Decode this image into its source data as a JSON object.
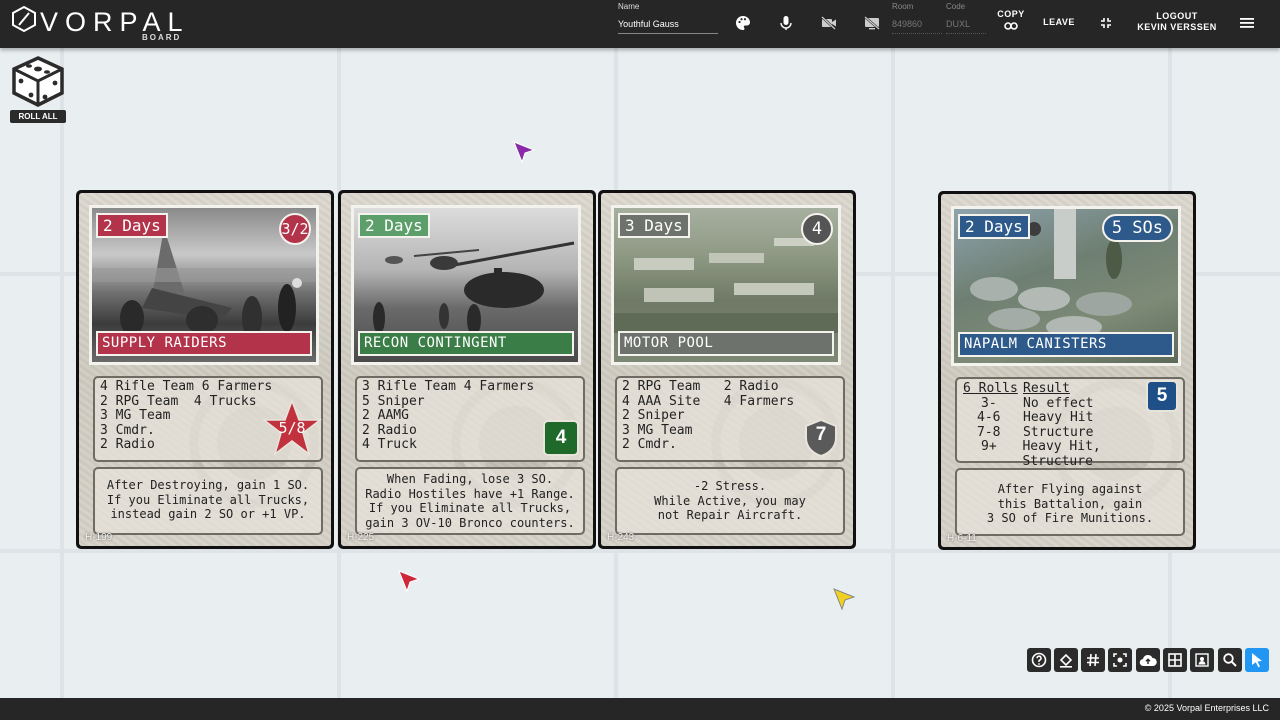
{
  "app": {
    "logo_text": "VORPAL",
    "logo_sub": "BOARD"
  },
  "header": {
    "name_label": "Name",
    "name_value": "Youthful Gauss",
    "room_label": "Room",
    "room_value": "849860",
    "code_label": "Code",
    "code_value": "DUXL",
    "copy_label": "COPY",
    "leave_label": "LEAVE",
    "logout_label": "LOGOUT",
    "user_name": "KEVIN VERSSEN"
  },
  "dice": {
    "label": "ROLL ALL"
  },
  "cards": [
    {
      "days": "2 Days",
      "title": "SUPPLY RAIDERS",
      "badge": "3/2",
      "units": "4 Rifle Team 6 Farmers\n2 RPG Team  4 Trucks\n3 MG Team\n3 Cmdr.\n2 Radio",
      "star_value": "5/8",
      "text": "After Destroying, gain 1 SO.\nIf you Eliminate all Trucks,\ninstead gain 2 SO or +1 VP.",
      "id": "H-199",
      "accent": "#b3344a"
    },
    {
      "days": "2 Days",
      "title": "RECON CONTINGENT",
      "badge": "",
      "units": "3 Rifle Team 4 Farmers\n5 Sniper\n2 AAMG\n2 Radio\n4 Truck",
      "square_value": "4",
      "text": "When Fading, lose 3 SO.\nRadio Hostiles have +1 Range.\nIf you Eliminate all Trucks,\ngain 3 OV-10 Bronco counters.",
      "id": "H-225",
      "accent": "#3a7d46"
    },
    {
      "days": "3 Days",
      "title": "MOTOR POOL",
      "badge": "4",
      "units": "2 RPG Team   2 Radio\n4 AAA Site   4 Farmers\n2 Sniper\n3 MG Team\n2 Cmdr.",
      "shield_value": "7",
      "text": "-2 Stress.\nWhile Active, you may\nnot Repair Aircraft.",
      "id": "H-243",
      "accent": "#6e726c"
    },
    {
      "days": "2 Days",
      "title": "NAPALM CANISTERS",
      "badge": "5 SOs",
      "table_header": [
        "6 Rolls",
        "Result"
      ],
      "table_rows": [
        [
          "3-",
          "No effect"
        ],
        [
          "4-6",
          "Heavy Hit"
        ],
        [
          "7-8",
          "Structure"
        ],
        [
          "9+",
          "Heavy Hit, Structure"
        ]
      ],
      "square_value": "5",
      "text": "After Flying against\nthis Battalion, gain\n3 SO of Fire Munitions.",
      "id": "H-6-11",
      "accent": "#2d5a8a"
    }
  ],
  "cursor_colors": [
    "#8a2aa8",
    "#d0263a",
    "#f0d020"
  ],
  "footer": {
    "copyright": "© 2025 Vorpal Enterprises LLC"
  }
}
